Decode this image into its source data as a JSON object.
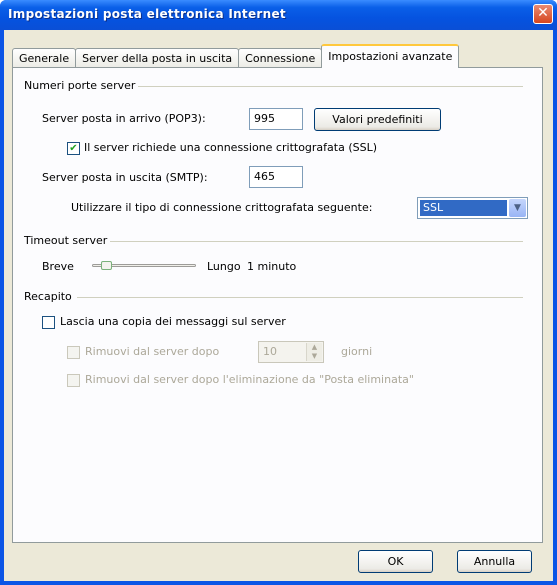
{
  "window": {
    "title": "Impostazioni posta elettronica Internet",
    "close_glyph": "✕"
  },
  "tabs": [
    {
      "label": "Generale",
      "active": false
    },
    {
      "label": "Server della posta in uscita",
      "active": false
    },
    {
      "label": "Connessione",
      "active": false
    },
    {
      "label": "Impostazioni avanzate",
      "active": true
    }
  ],
  "ports": {
    "group_title": "Numeri porte server",
    "incoming_label": "Server posta in arrivo (POP3):",
    "incoming_value": "995",
    "defaults_button": "Valori predefiniti",
    "ssl_checkbox_label": "Il server richiede una connessione crittografata (SSL)",
    "ssl_checked": true,
    "outgoing_label": "Server posta in uscita (SMTP):",
    "outgoing_value": "465",
    "encryption_label": "Utilizzare il tipo di connessione crittografata seguente:",
    "encryption_value": "SSL"
  },
  "timeout": {
    "group_title": "Timeout server",
    "short_label": "Breve",
    "long_label": "Lungo",
    "value_text": "1 minuto",
    "level_fraction": 0.1
  },
  "delivery": {
    "group_title": "Recapito",
    "leave_copy_label": "Lascia una copia dei messaggi sul server",
    "leave_copy_checked": false,
    "remove_after_label": "Rimuovi dal server dopo",
    "remove_after_value": "10",
    "days_label": "giorni",
    "remove_deleted_label": "Rimuovi dal server dopo l'eliminazione da \"Posta eliminata\""
  },
  "footer": {
    "ok_label": "OK",
    "cancel_label": "Annulla"
  }
}
